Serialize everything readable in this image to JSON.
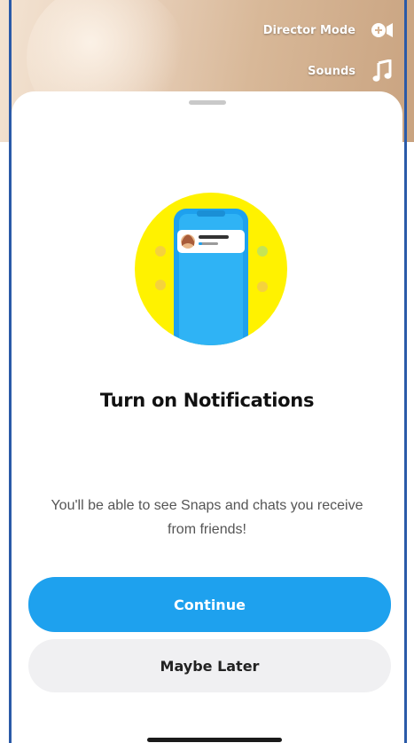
{
  "camera": {
    "director_mode_label": "Director Mode",
    "director_mode_icon": "video-plus-icon",
    "sounds_label": "Sounds",
    "sounds_icon": "music-note-icon"
  },
  "sheet": {
    "illustration_icon": "phone-notification-illustration",
    "title": "Turn on Notifications",
    "subtitle": "You'll be able to see Snaps and chats you receive from friends!",
    "continue_label": "Continue",
    "maybe_later_label": "Maybe Later"
  },
  "colors": {
    "accent_blue": "#1ea1ee",
    "snap_yellow": "#fff200",
    "secondary_button": "#f0f0f2"
  }
}
